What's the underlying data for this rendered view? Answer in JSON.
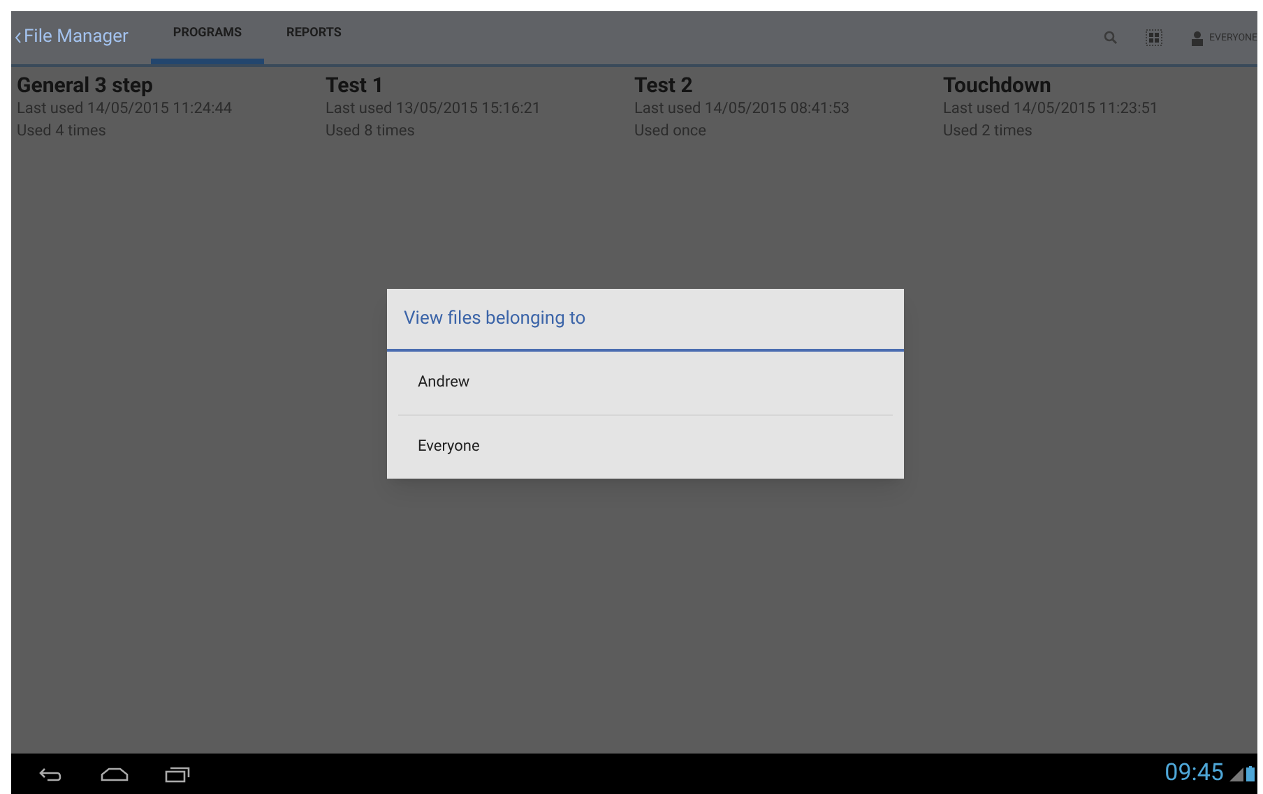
{
  "action_bar": {
    "back_title": "File Manager",
    "tabs": [
      {
        "label": "PROGRAMS",
        "selected": true
      },
      {
        "label": "REPORTS",
        "selected": false
      }
    ],
    "account": "EVERYONE"
  },
  "programs": [
    {
      "name": "General 3 step",
      "last_used": "Last used 14/05/2015 11:24:44",
      "usage": "Used 4 times"
    },
    {
      "name": "Test 1",
      "last_used": "Last used 13/05/2015 15:16:21",
      "usage": "Used 8 times"
    },
    {
      "name": "Test 2",
      "last_used": "Last used 14/05/2015 08:41:53",
      "usage": "Used once"
    },
    {
      "name": "Touchdown",
      "last_used": "Last used 14/05/2015 11:23:51",
      "usage": "Used 2 times"
    }
  ],
  "dialog": {
    "title": "View files belonging to",
    "options": [
      "Andrew",
      "Everyone"
    ]
  },
  "status_bar": {
    "time": "09:45"
  }
}
